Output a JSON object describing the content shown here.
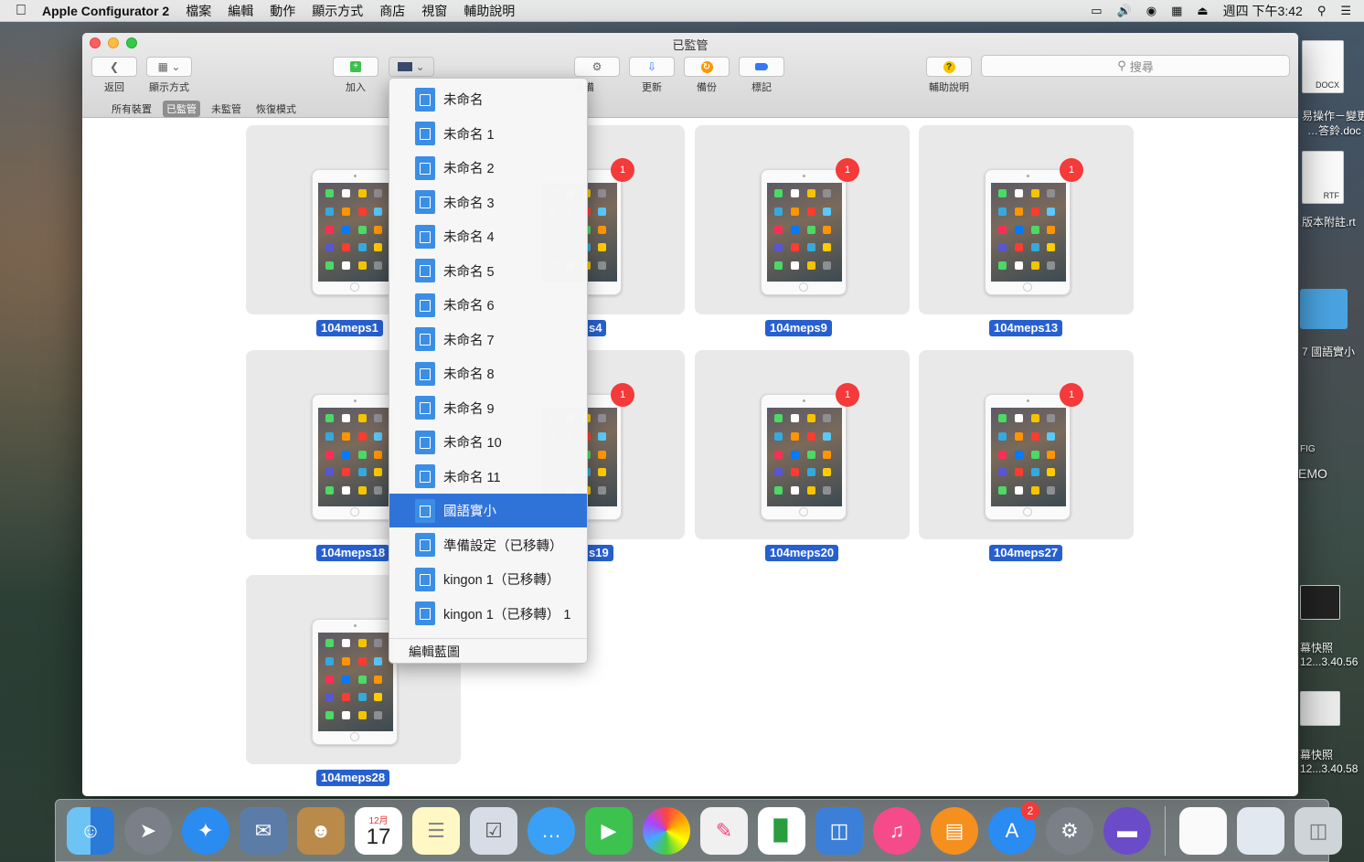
{
  "menubar": {
    "app_name": "Apple Configurator 2",
    "menus": [
      "檔案",
      "編輯",
      "動作",
      "顯示方式",
      "商店",
      "視窗",
      "輔助說明"
    ],
    "clock": "週四 下午3:42"
  },
  "window": {
    "title": "已監管",
    "toolbar": {
      "back_label": "返回",
      "view_label": "顯示方式",
      "add_label": "加入",
      "prepare_label": "準備",
      "update_label": "更新",
      "backup_label": "備份",
      "tag_label": "標記",
      "help_label": "輔助說明",
      "search_placeholder": "搜尋"
    },
    "scopes": [
      "所有裝置",
      "已監管",
      "未監管",
      "恢復模式"
    ],
    "active_scope": "已監管"
  },
  "devices": [
    {
      "name": "104meps1",
      "badge": ""
    },
    {
      "name": "104meps4",
      "badge": "1"
    },
    {
      "name": "104meps9",
      "badge": "1"
    },
    {
      "name": "104meps13",
      "badge": "1"
    },
    {
      "name": "104meps18",
      "badge": ""
    },
    {
      "name": "104meps19",
      "badge": "1"
    },
    {
      "name": "104meps20",
      "badge": "1"
    },
    {
      "name": "104meps27",
      "badge": "1"
    },
    {
      "name": "104meps28",
      "badge": ""
    }
  ],
  "device_labels_visible": {
    "d0": "104meps1",
    "d1": "s4",
    "d2": "104meps9",
    "d3": "104meps13",
    "d4": "104meps18",
    "d5": "s19",
    "d6": "104meps20",
    "d7": "104meps27",
    "d8": "104meps28"
  },
  "blueprint_menu": {
    "items": [
      "未命名",
      "未命名 1",
      "未命名 2",
      "未命名 3",
      "未命名 4",
      "未命名 5",
      "未命名 6",
      "未命名 7",
      "未命名 8",
      "未命名 9",
      "未命名 10",
      "未命名 11",
      "國語實小",
      "準備設定（已移轉）",
      "kingon 1（已移轉）",
      "kingon 1（已移轉） 1"
    ],
    "selected_index": 12,
    "footer": "編輯藍圖"
  },
  "desktop_items": {
    "docx_tag": "DOCX",
    "docx_name1": "易操作－變更",
    "docx_name2": "…答鈴.doc",
    "rtf_tag": "RTF",
    "rtf_name": "版本附註.rt",
    "folder_name": "7 國語實小",
    "fig_tag": "FIG",
    "emo": "EMO",
    "shot1_name1": "幕快照",
    "shot1_name2": "12...3.40.56",
    "shot2_name1": "幕快照",
    "shot2_name2": "12...3.40.58"
  },
  "dock": {
    "calendar_month": "12月",
    "calendar_day": "17",
    "appstore_badge": "2"
  }
}
